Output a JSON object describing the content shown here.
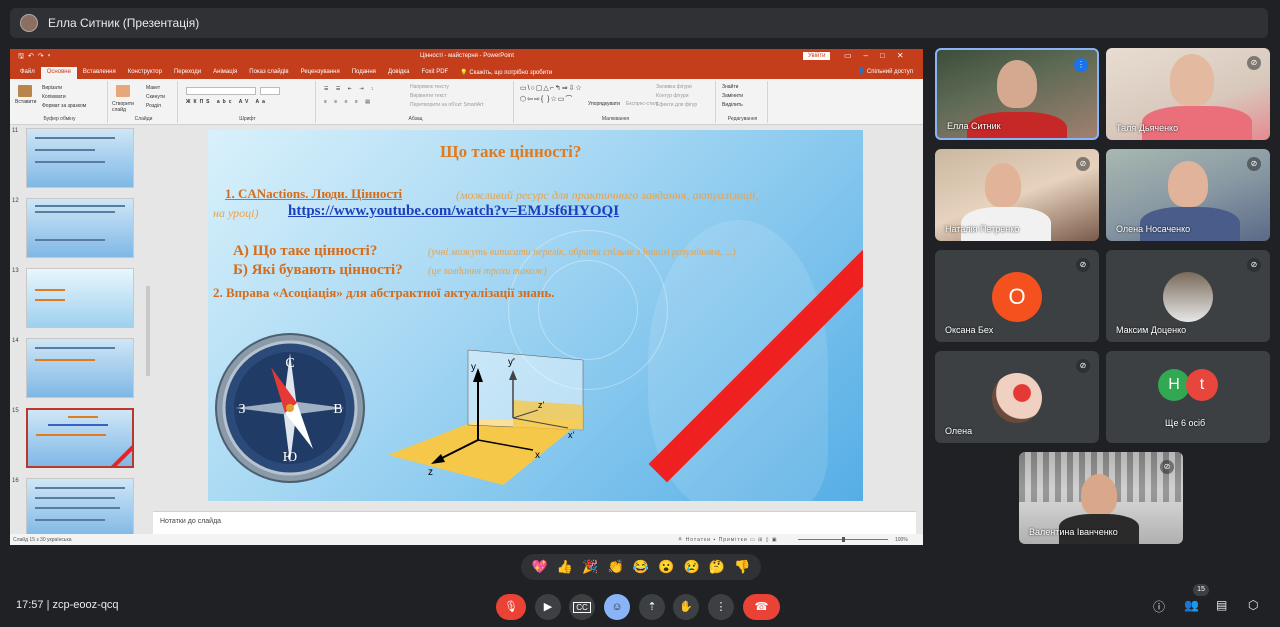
{
  "presenter_bar": {
    "label": "Елла Ситник (Презентація)"
  },
  "ppt": {
    "title": "Цінності - майстерня - PowerPoint",
    "signin": "Увійти",
    "tabs": [
      "Файл",
      "Основне",
      "Вставлення",
      "Конструктор",
      "Переходи",
      "Анімація",
      "Показ слайдів",
      "Рецензування",
      "Подання",
      "Довідка",
      "Foxit PDF"
    ],
    "tell_me": "Скажіть, що потрібно зробити",
    "share": "Спільний доступ",
    "ribbon": {
      "clipboard": {
        "paste": "Вставити",
        "cut": "Вирізати",
        "copy": "Копіювати",
        "format": "Формат за зразком",
        "label": "Буфер обміну"
      },
      "slides": {
        "new": "Створити слайд",
        "layout": "Макет",
        "reset": "Скинути",
        "section": "Розділ",
        "label": "Слайди"
      },
      "font": {
        "label": "Шрифт"
      },
      "paragraph": {
        "dir": "Напрямок тексту",
        "align": "Вирівняти текст",
        "smart": "Перетворити на об'єкт SmartArt",
        "label": "Абзац"
      },
      "drawing": {
        "arrange": "Упорядкувати",
        "styles": "Експрес-стилі",
        "fill": "Заливка фігури",
        "outline": "Контур фігури",
        "effects": "Ефекти для фігур",
        "label": "Малювання"
      },
      "editing": {
        "find": "Знайти",
        "replace": "Замінити",
        "select": "Виділить",
        "label": "Редагування"
      }
    },
    "thumbnails": [
      "11",
      "12",
      "13",
      "14",
      "15",
      "16"
    ],
    "thumb16_text": "Цінності — це властивості, предмета, моральності, що створюються життєвих явищ і ідеалізується в загалом",
    "slide": {
      "title": "Що таке цінності?",
      "line1": "1. CANactions. Люди. Цінності",
      "line1_note": "(можливий ресурс для практичного завдання, актуалізації,",
      "line2_note": "на уроці)",
      "link": "https://www.youtube.com/watch?v=EMJsf6HYOQI",
      "a": "А)  Що таке цінності?",
      "a_note": "(учні можуть виписати перелік, обрати спільне з іншим розумінням, ...)",
      "b": "Б)  Які бувають цінності?",
      "b_note": "(це завдання трохи також)",
      "item2": "2. Вправа «Асоціація» для абстрактної актуалізації знань.",
      "compass": {
        "n": "С",
        "s": "Ю",
        "w": "З",
        "e": "В"
      },
      "axes": {
        "y": "y",
        "y2": "y'",
        "z": "z",
        "z2": "z'",
        "x": "x",
        "x2": "x'"
      }
    },
    "notes": "Нотатки до слайда",
    "status": {
      "slide": "Слайд 15 з 30",
      "lang": "українська",
      "notes": "Нотатки",
      "comments": "Примітки",
      "zoom": "100%"
    }
  },
  "participants": [
    {
      "name": "Елла Ситник",
      "speaking": true
    },
    {
      "name": "Таля Дьяченко",
      "muted": true
    },
    {
      "name": "Наталія Петренко",
      "muted": true
    },
    {
      "name": "Олена Носаченко",
      "muted": true
    },
    {
      "name": "Оксана Бех",
      "initial": "О",
      "color": "#f4511e",
      "muted": true
    },
    {
      "name": "Максим Доценко",
      "muted": true
    },
    {
      "name": "Олена",
      "muted": true
    },
    {
      "name": "Ще 6 осіб",
      "initials": [
        "Н",
        "t"
      ],
      "colors": [
        "#33a852",
        "#e8453c"
      ]
    },
    {
      "name": "Валентина Іванченко",
      "muted": true
    }
  ],
  "bottom": {
    "time": "17:57",
    "meeting": "zcp-eooz-qcq",
    "people_count": "15"
  },
  "reactions": [
    "💖",
    "👍",
    "🎉",
    "👏",
    "😂",
    "😮",
    "😢",
    "🤔",
    "👎"
  ]
}
